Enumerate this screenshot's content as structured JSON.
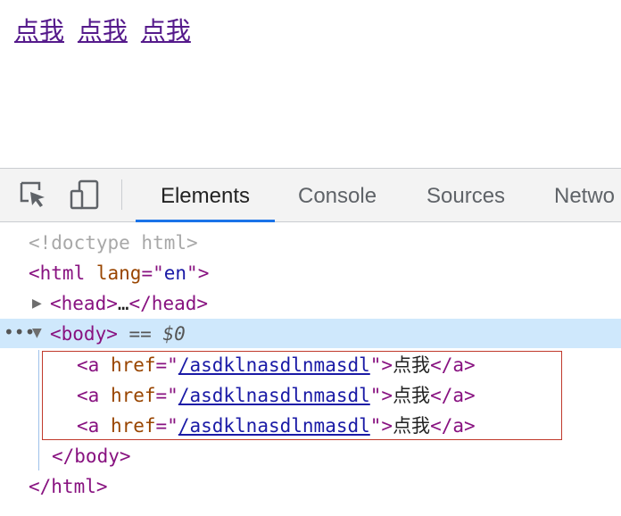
{
  "preview": {
    "links": [
      "点我",
      "点我",
      "点我"
    ]
  },
  "devtools": {
    "tabs": {
      "elements": "Elements",
      "console": "Console",
      "sources": "Sources",
      "network": "Netwo"
    },
    "tree": {
      "doctype": "<!doctype html>",
      "html_open_tag": "<html",
      "html_lang_attr": "lang",
      "html_lang_value": "en",
      "head_tag": "<head>",
      "head_ellipsis": "…",
      "head_close": "</head>",
      "body_tag": "<body>",
      "selected_marker": "== $0",
      "anchors": [
        {
          "open": "<a",
          "attr": "href",
          "href": "/asdklnasdlnmasdl",
          "text": "点我",
          "close": "</a>"
        },
        {
          "open": "<a",
          "attr": "href",
          "href": "/asdklnasdlnmasdl",
          "text": "点我",
          "close": "</a>"
        },
        {
          "open": "<a",
          "attr": "href",
          "href": "/asdklnasdlnmasdl",
          "text": "点我",
          "close": "</a>"
        }
      ],
      "body_close": "</body>",
      "html_close": "</html>"
    }
  }
}
